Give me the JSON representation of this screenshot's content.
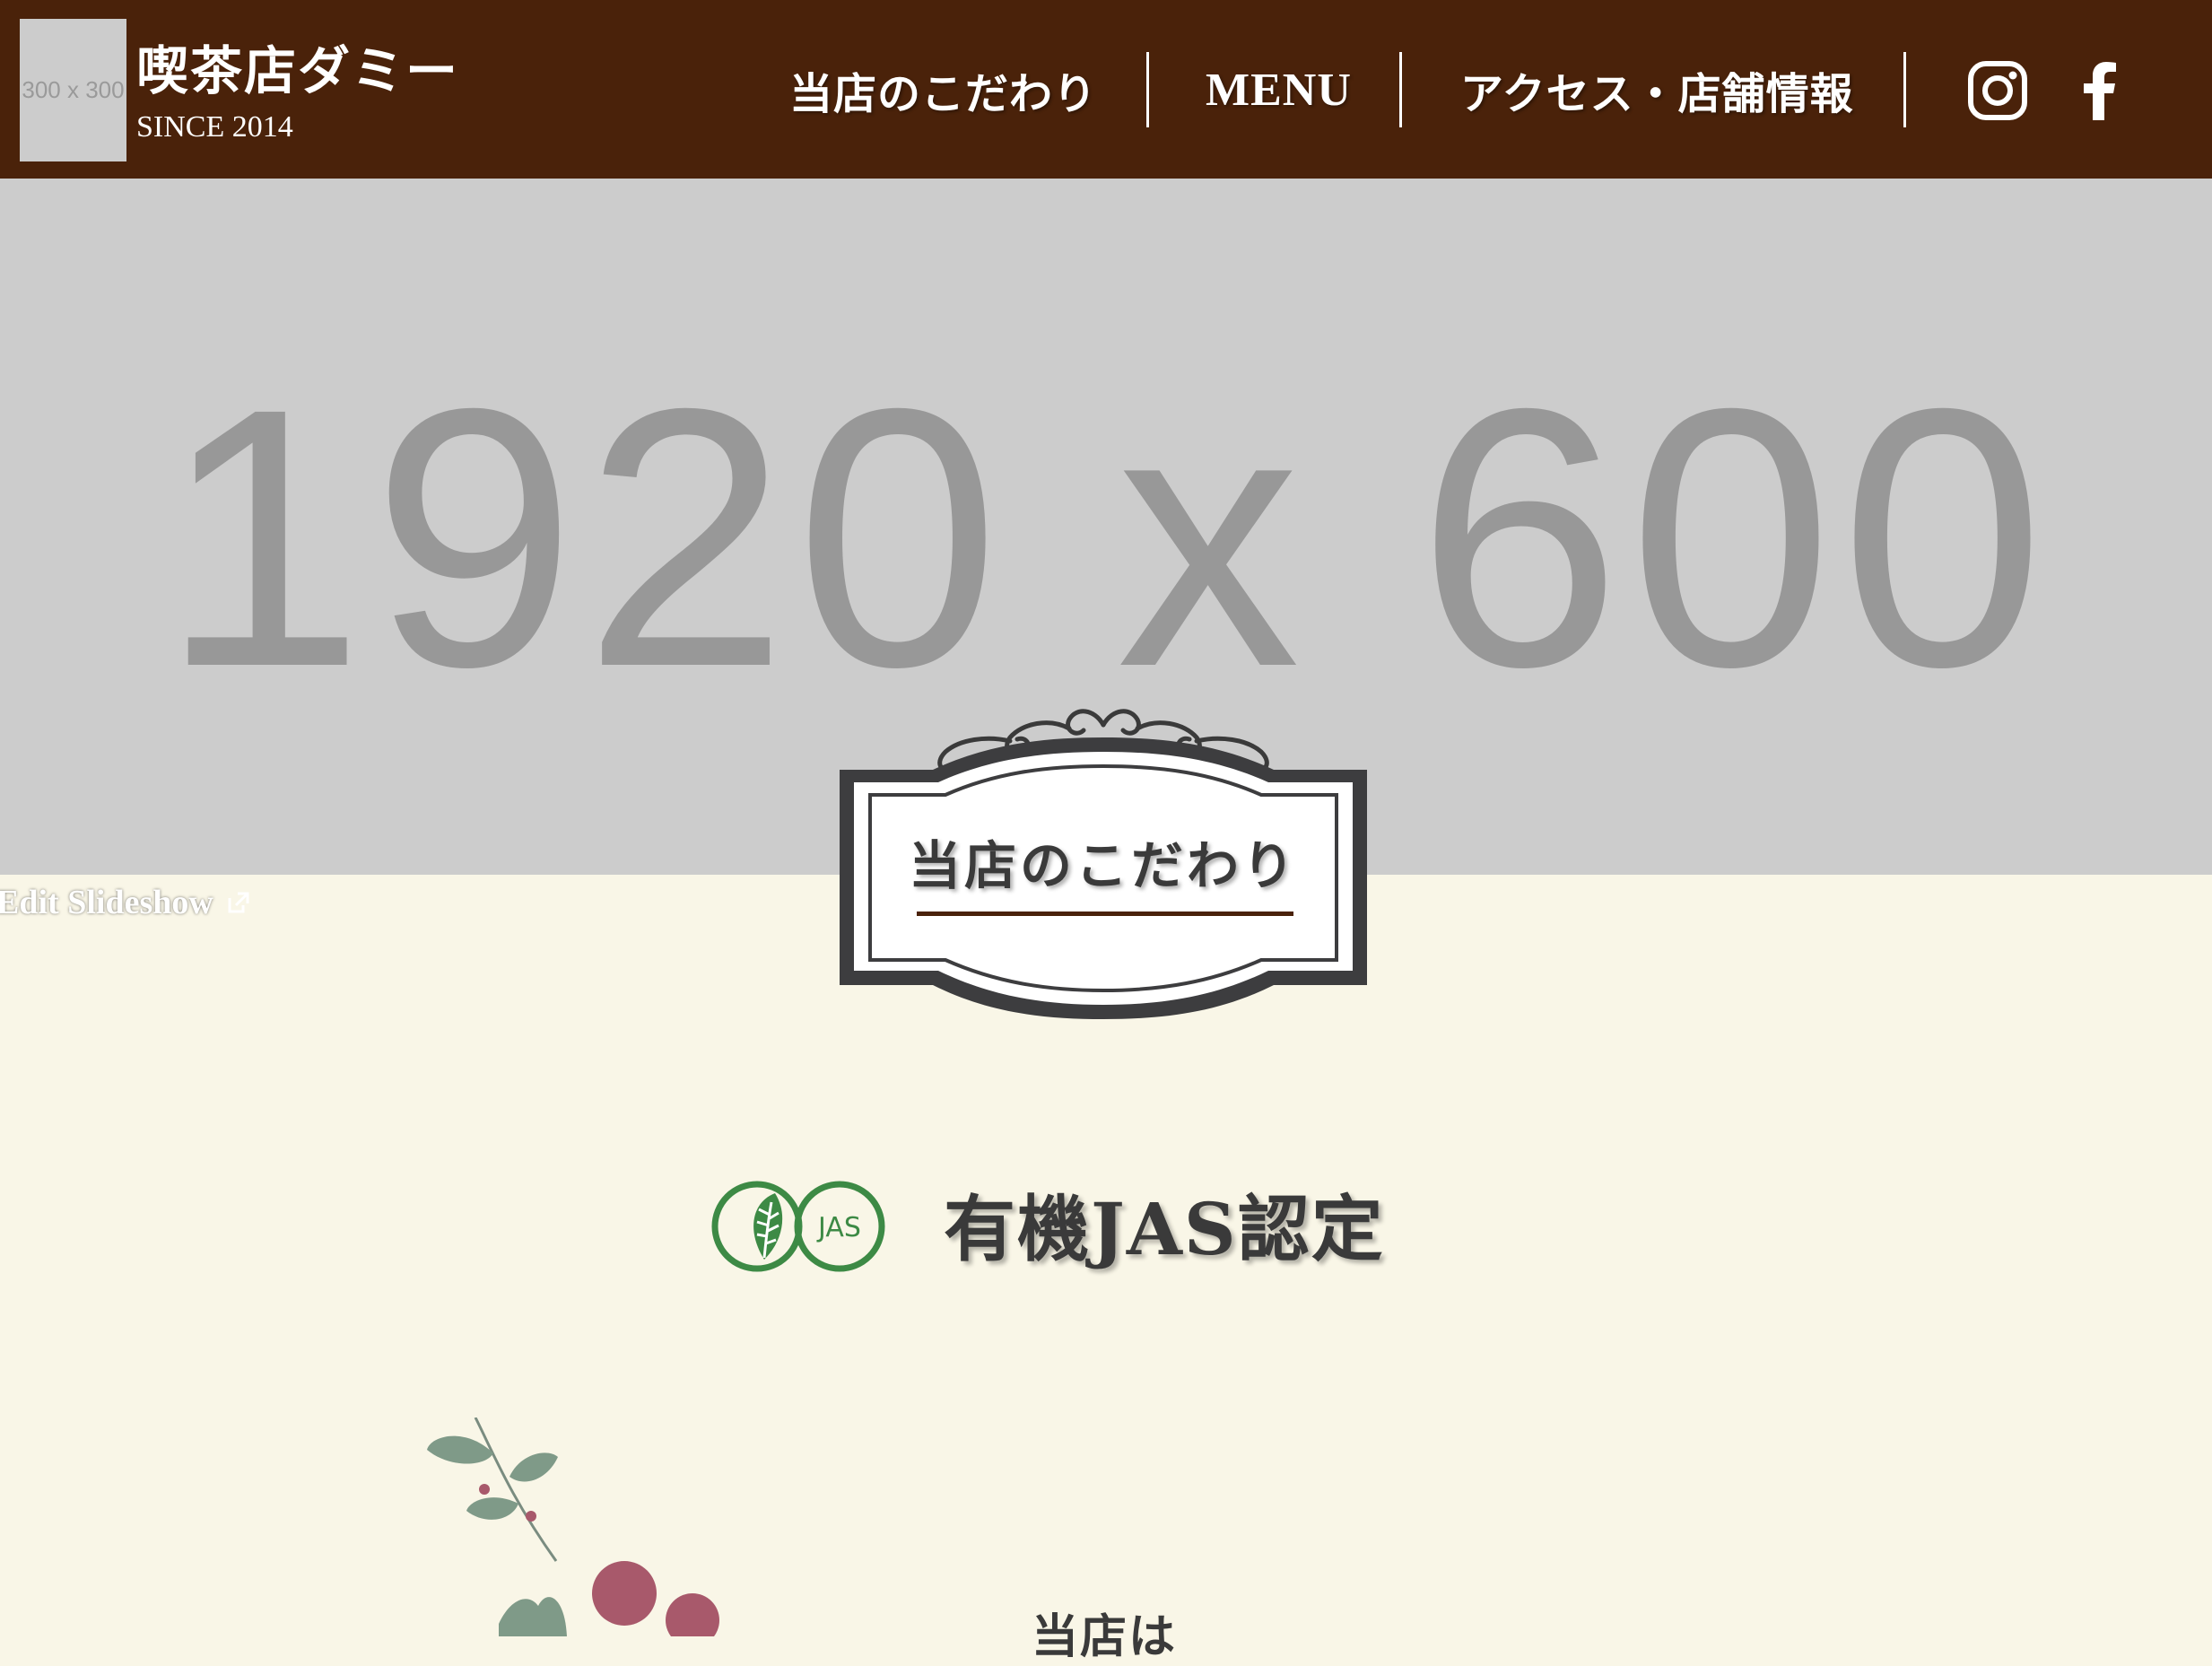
{
  "header": {
    "logo_placeholder": "300 x 300",
    "shop_name": "喫茶店ダミー",
    "since": "SINCE 2014",
    "nav": [
      {
        "label": "当店のこだわり"
      },
      {
        "label": "MENU"
      },
      {
        "label": "アクセス・店舗情報"
      }
    ],
    "social_icons": [
      "instagram-icon",
      "facebook-icon"
    ]
  },
  "hero": {
    "placeholder_text": "1920 x 600",
    "edit_label": "Edit Slideshow"
  },
  "section": {
    "title": "当店のこだわり",
    "jas_logo_text": "JAS",
    "jas_heading": "有機JAS認定",
    "body_start": "当店は"
  },
  "colors": {
    "header_bg": "#4a220a",
    "page_bg": "#f9f6e7",
    "hero_bg": "#cccccc",
    "jas_green": "#3d8a45"
  }
}
